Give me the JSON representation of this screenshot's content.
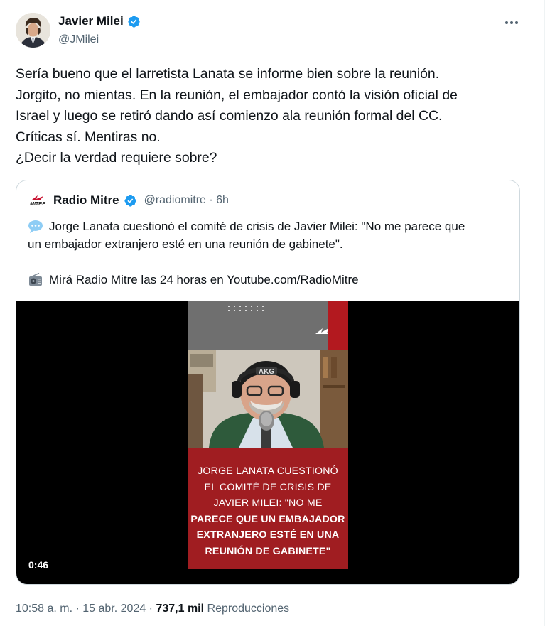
{
  "author": {
    "name": "Javier Milei",
    "handle": "@JMilei",
    "verified_icon": "verified-badge-icon",
    "more_icon": "more-options-icon"
  },
  "tweet": {
    "lines": [
      "Sería bueno que el larretista Lanata se informe bien sobre la reunión.",
      "Jorgito, no mientas. En la reunión, el embajador contó la visión oficial de",
      "Israel y luego se retiró dando así comienzo ala reunión formal del CC.",
      "Críticas sí. Mentiras no.",
      "¿Decir la verdad requiere sobre?"
    ]
  },
  "quote": {
    "name": "Radio Mitre",
    "meta": "@radiomitre · 6h",
    "logo_icon": "radio-mitre-logo-icon",
    "text_line1": "Jorge Lanata cuestionó el comité de crisis de Javier Milei: \"No me parece que",
    "text_line2": "un embajador extranjero esté en una reunión de gabinete\".",
    "text_line3": "Mirá Radio Mitre las 24 horas en Youtube.com/RadioMitre",
    "speech_icon": "speech-balloon-icon",
    "radio_icon": "radio-icon",
    "video": {
      "duration": "0:46",
      "caption": [
        "JORGE LANATA CUESTIONÓ",
        "EL COMITÉ DE CRISIS DE",
        "JAVIER MILEI: \"NO ME",
        "PARECE QUE UN EMBAJADOR",
        "EXTRANJERO ESTÉ EN UNA",
        "REUNIÓN DE GABINETE\""
      ]
    }
  },
  "footer": {
    "time_date": "10:58 a. m. · 15 abr. 2024 · ",
    "views_count": "737,1 mil",
    "views_label": " Reproducciones"
  },
  "colors": {
    "text_primary": "#0f1419",
    "text_secondary": "#536471",
    "verified_blue": "#1d9bf0",
    "border": "#cfd9de",
    "caption_red": "#a01d21"
  }
}
